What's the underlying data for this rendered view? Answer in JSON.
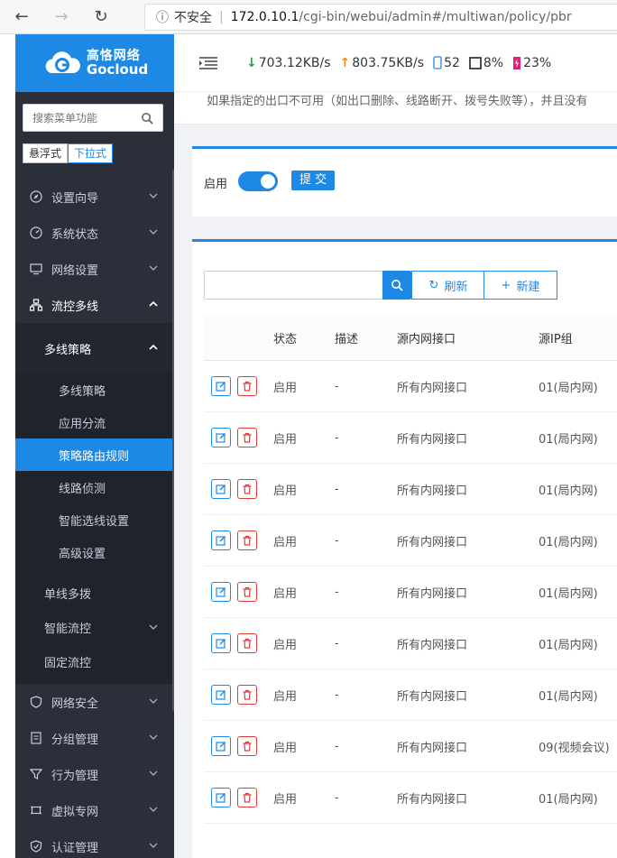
{
  "browser": {
    "security_label": "不安全",
    "host": "172.0.10.1",
    "path": "/cgi-bin/webui/admin#/multiwan/policy/pbr"
  },
  "logo": {
    "cn": "高恪网络",
    "en": "Gocloud"
  },
  "sidebar": {
    "search_placeholder": "搜索菜单功能",
    "mode_float": "悬浮式",
    "mode_dropdown": "下拉式",
    "menu": [
      {
        "label": "设置向导",
        "icon": "compass-icon"
      },
      {
        "label": "系统状态",
        "icon": "gauge-icon"
      },
      {
        "label": "网络设置",
        "icon": "monitor-icon"
      },
      {
        "label": "流控多线",
        "icon": "network-icon"
      }
    ],
    "sub_head": "多线策略",
    "leaves": [
      {
        "label": "多线策略"
      },
      {
        "label": "应用分流"
      },
      {
        "label": "策略路由规则"
      },
      {
        "label": "线路侦测"
      },
      {
        "label": "智能选线设置"
      },
      {
        "label": "高级设置"
      }
    ],
    "sub2": [
      {
        "label": "单线多拨",
        "chevron": false
      },
      {
        "label": "智能流控",
        "chevron": true
      },
      {
        "label": "固定流控",
        "chevron": false
      }
    ],
    "menu_bottom": [
      {
        "label": "网络安全",
        "icon": "shield-icon"
      },
      {
        "label": "分组管理",
        "icon": "document-icon"
      },
      {
        "label": "行为管理",
        "icon": "filter-icon"
      },
      {
        "label": "虚拟专网",
        "icon": "vpn-icon"
      },
      {
        "label": "认证管理",
        "icon": "check-shield-icon"
      }
    ]
  },
  "topbar": {
    "download": "703.12KB/s",
    "upload": "803.75KB/s",
    "connections": "52",
    "cpu": "8%",
    "memory": "23%"
  },
  "notice": "如果指定的出口不可用（如出口删除、线路断开、拨号失败等），并且没有",
  "panel1": {
    "enable_label": "启用",
    "submit_label": "提 交"
  },
  "toolbar": {
    "refresh_label": "刷新",
    "new_label": "新建"
  },
  "table": {
    "headers": [
      "状态",
      "描述",
      "源内网接口",
      "源IP组"
    ],
    "rows": [
      {
        "status": "启用",
        "desc": "-",
        "iface": "所有内网接口",
        "ipgroup": "01(局内网)"
      },
      {
        "status": "启用",
        "desc": "-",
        "iface": "所有内网接口",
        "ipgroup": "01(局内网)"
      },
      {
        "status": "启用",
        "desc": "-",
        "iface": "所有内网接口",
        "ipgroup": "01(局内网)"
      },
      {
        "status": "启用",
        "desc": "-",
        "iface": "所有内网接口",
        "ipgroup": "01(局内网)"
      },
      {
        "status": "启用",
        "desc": "-",
        "iface": "所有内网接口",
        "ipgroup": "01(局内网)"
      },
      {
        "status": "启用",
        "desc": "-",
        "iface": "所有内网接口",
        "ipgroup": "01(局内网)"
      },
      {
        "status": "启用",
        "desc": "-",
        "iface": "所有内网接口",
        "ipgroup": "01(局内网)"
      },
      {
        "status": "启用",
        "desc": "-",
        "iface": "所有内网接口",
        "ipgroup": "09(视频会议)"
      },
      {
        "status": "启用",
        "desc": "-",
        "iface": "所有内网接口",
        "ipgroup": "01(局内网)"
      }
    ]
  },
  "colors": {
    "accent": "#1e88e5",
    "sidebar_bg": "#2b2f3a",
    "danger": "#e53935",
    "down": "#2e9b3e",
    "up": "#f08c1a"
  }
}
